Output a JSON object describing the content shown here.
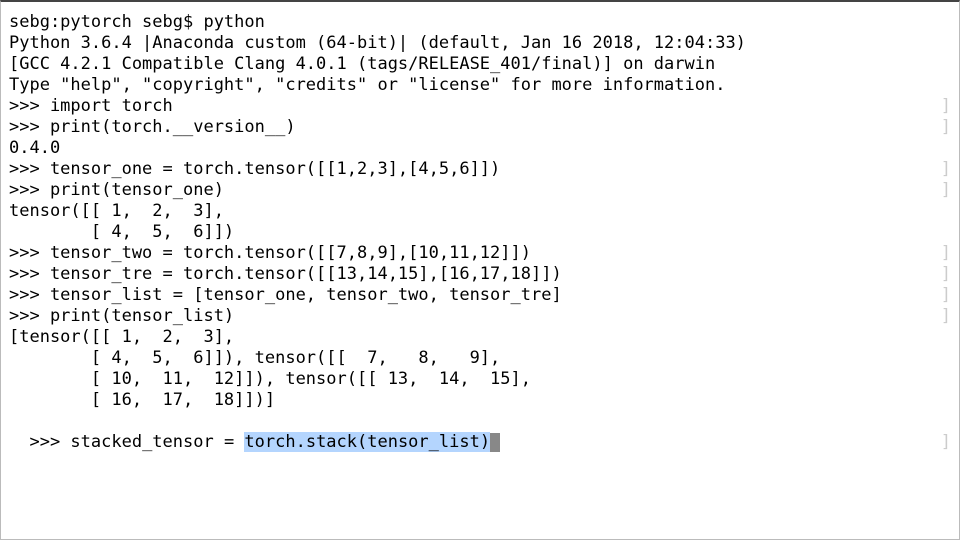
{
  "terminal": {
    "lines": [
      {
        "text": "sebg:pytorch sebg$ python",
        "hint": ""
      },
      {
        "text": "Python 3.6.4 |Anaconda custom (64-bit)| (default, Jan 16 2018, 12:04:33)",
        "hint": ""
      },
      {
        "text": "[GCC 4.2.1 Compatible Clang 4.0.1 (tags/RELEASE_401/final)] on darwin",
        "hint": ""
      },
      {
        "text": "Type \"help\", \"copyright\", \"credits\" or \"license\" for more information.",
        "hint": ""
      },
      {
        "text": ">>> import torch",
        "hint": "]"
      },
      {
        "text": ">>> print(torch.__version__)",
        "hint": "]"
      },
      {
        "text": "0.4.0",
        "hint": ""
      },
      {
        "text": ">>> tensor_one = torch.tensor([[1,2,3],[4,5,6]])",
        "hint": "]"
      },
      {
        "text": ">>> print(tensor_one)",
        "hint": "]"
      },
      {
        "text": "tensor([[ 1,  2,  3],",
        "hint": ""
      },
      {
        "text": "        [ 4,  5,  6]])",
        "hint": ""
      },
      {
        "text": ">>> tensor_two = torch.tensor([[7,8,9],[10,11,12]])",
        "hint": "]"
      },
      {
        "text": ">>> tensor_tre = torch.tensor([[13,14,15],[16,17,18]])",
        "hint": "]"
      },
      {
        "text": ">>> tensor_list = [tensor_one, tensor_two, tensor_tre]",
        "hint": "]"
      },
      {
        "text": ">>> print(tensor_list)",
        "hint": "]"
      },
      {
        "text": "[tensor([[ 1,  2,  3],",
        "hint": ""
      },
      {
        "text": "        [ 4,  5,  6]]), tensor([[  7,   8,   9],",
        "hint": ""
      },
      {
        "text": "        [ 10,  11,  12]]), tensor([[ 13,  14,  15],",
        "hint": ""
      },
      {
        "text": "        [ 16,  17,  18]])]",
        "hint": ""
      }
    ],
    "current_line": {
      "prefix": ">>> stacked_tensor = ",
      "selected": "torch.stack(tensor_list)",
      "hint": "]"
    }
  }
}
